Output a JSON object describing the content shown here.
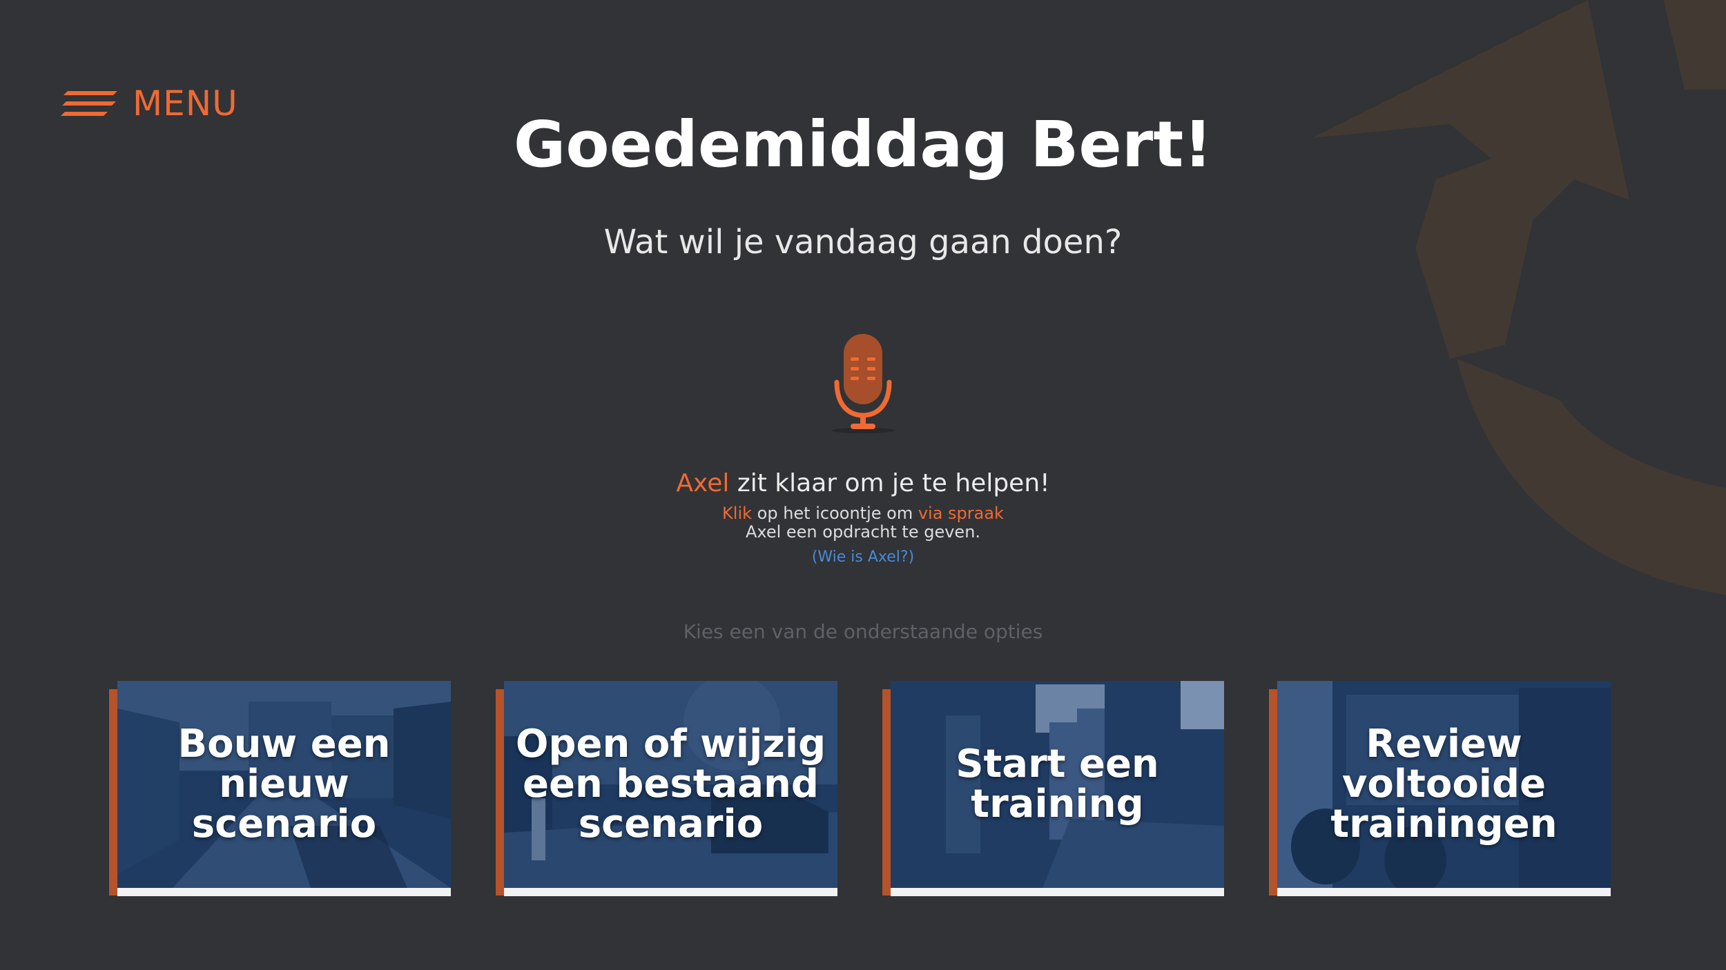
{
  "colors": {
    "background": "#313336",
    "accent": "#f06a33",
    "card_overlay": "#1e3a60",
    "card_shadow": "#b5532b",
    "link": "#4a8ad8",
    "muted_text": "#5e6166"
  },
  "menu": {
    "icon": "hamburger-icon",
    "label": "MENU"
  },
  "greeting": {
    "title": "Goedemiddag Bert!",
    "subtitle": "Wat wil je vandaag gaan doen?"
  },
  "assistant": {
    "icon": "microphone-icon",
    "name": "Axel",
    "ready_text": " zit klaar om je te helpen!",
    "help_click": "Klik",
    "help_mid": " op het icoontje om ",
    "help_voice": "via spraak",
    "help_line2": "Axel een opdracht te geven.",
    "who_link": "(Wie is Axel?)"
  },
  "options": {
    "prompt": "Kies een van de onderstaande opties",
    "cards": [
      {
        "label": "Bouw een nieuw scenario"
      },
      {
        "label": "Open of wijzig een bestaand scenario"
      },
      {
        "label": "Start een training"
      },
      {
        "label": "Review voltooide trainingen"
      }
    ]
  }
}
